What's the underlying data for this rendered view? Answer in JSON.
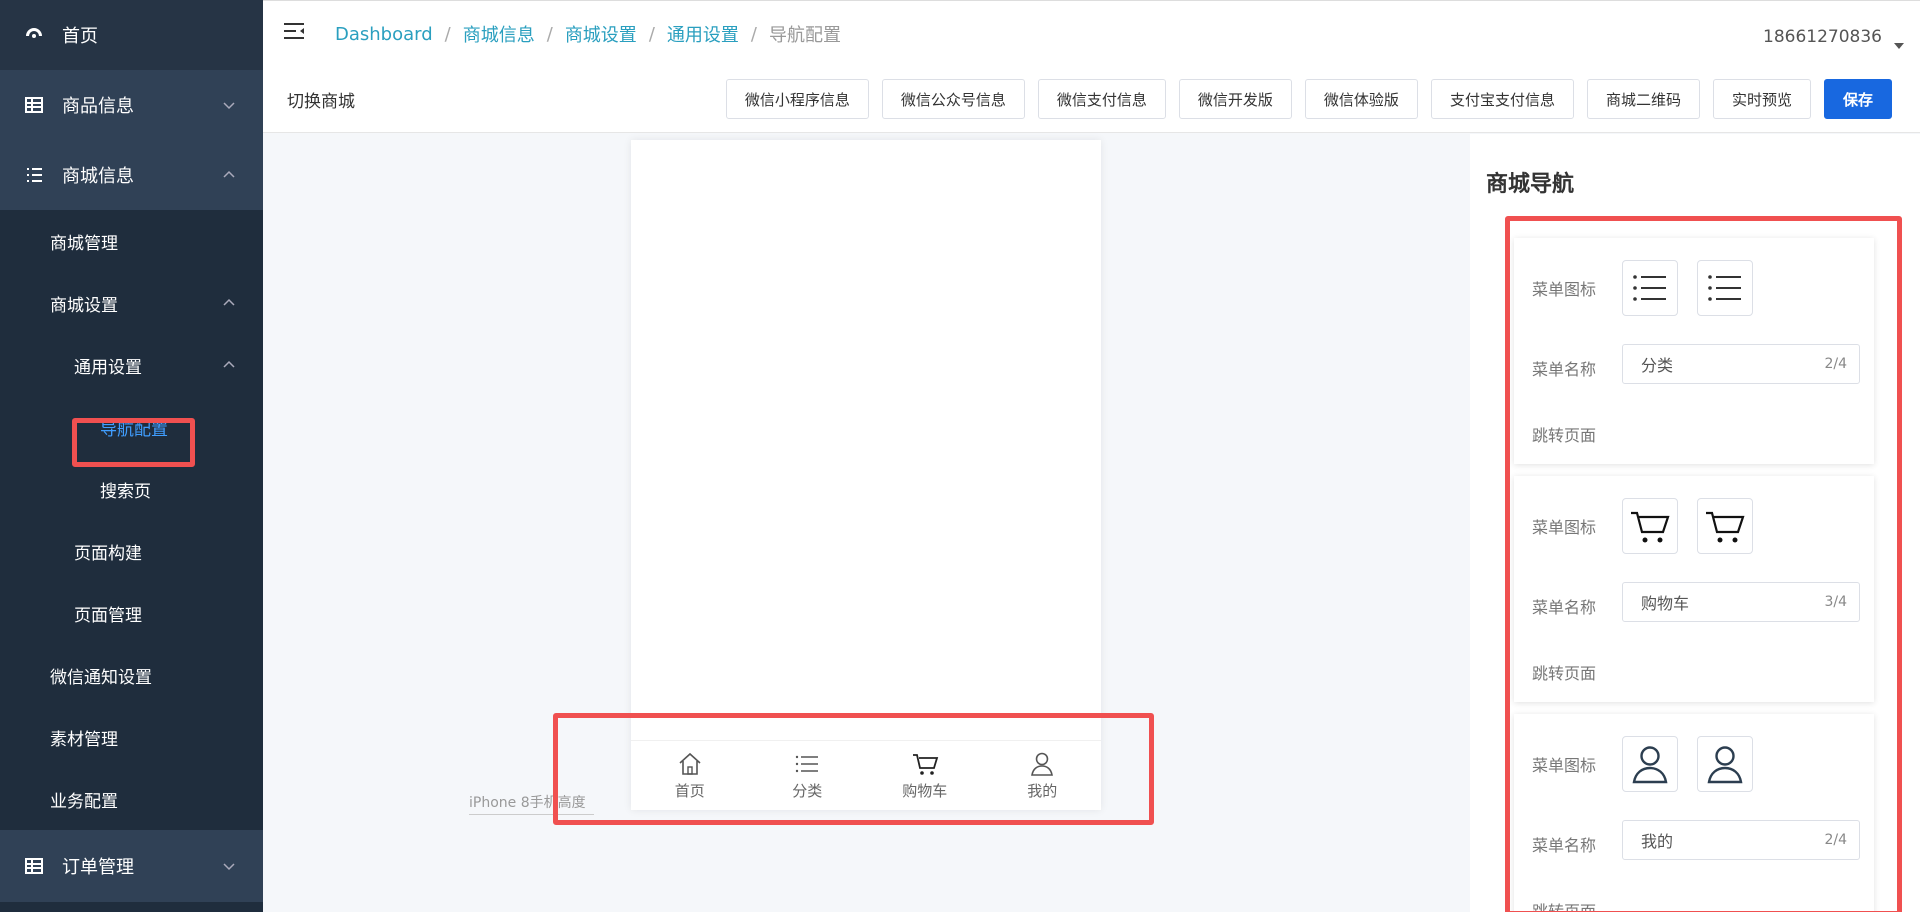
{
  "sidebar": {
    "home": "首页",
    "goods": "商品信息",
    "mall_info": "商城信息",
    "mall_manage": "商城管理",
    "mall_settings": "商城设置",
    "general_settings": "通用设置",
    "nav_config": "导航配置",
    "search_page": "搜索页",
    "page_build": "页面构建",
    "page_manage": "页面管理",
    "wechat_notify": "微信通知设置",
    "material": "素材管理",
    "business_config": "业务配置",
    "orders": "订单管理"
  },
  "header": {
    "breadcrumb": [
      "Dashboard",
      "商城信息",
      "商城设置",
      "通用设置",
      "导航配置"
    ],
    "user": "18661270836",
    "switch_shop": "切换商城",
    "actions": [
      "微信小程序信息",
      "微信公众号信息",
      "微信支付信息",
      "微信开发版",
      "微信体验版",
      "支付宝支付信息",
      "商城二维码",
      "实时预览"
    ],
    "save": "保存"
  },
  "preview": {
    "nav": [
      {
        "label": "首页",
        "icon": "home-icon"
      },
      {
        "label": "分类",
        "icon": "list-icon"
      },
      {
        "label": "购物车",
        "icon": "cart-icon"
      },
      {
        "label": "我的",
        "icon": "user-icon"
      }
    ],
    "device_label": "iPhone 8手机高度"
  },
  "panel": {
    "title": "商城导航",
    "icon_label": "菜单图标",
    "name_label": "菜单名称",
    "jump_label": "跳转页面",
    "cards": [
      {
        "icon": "list-icon",
        "name": "分类",
        "count": "2/4"
      },
      {
        "icon": "cart-icon",
        "name": "购物车",
        "count": "3/4"
      },
      {
        "icon": "user-icon",
        "name": "我的",
        "count": "2/4"
      }
    ]
  },
  "colors": {
    "sidebar_bg": "#1f2d3d",
    "accent": "#409eff",
    "primary_button": "#1868e0",
    "highlight": "#f05050",
    "breadcrumb_link": "#2a9fbf"
  }
}
